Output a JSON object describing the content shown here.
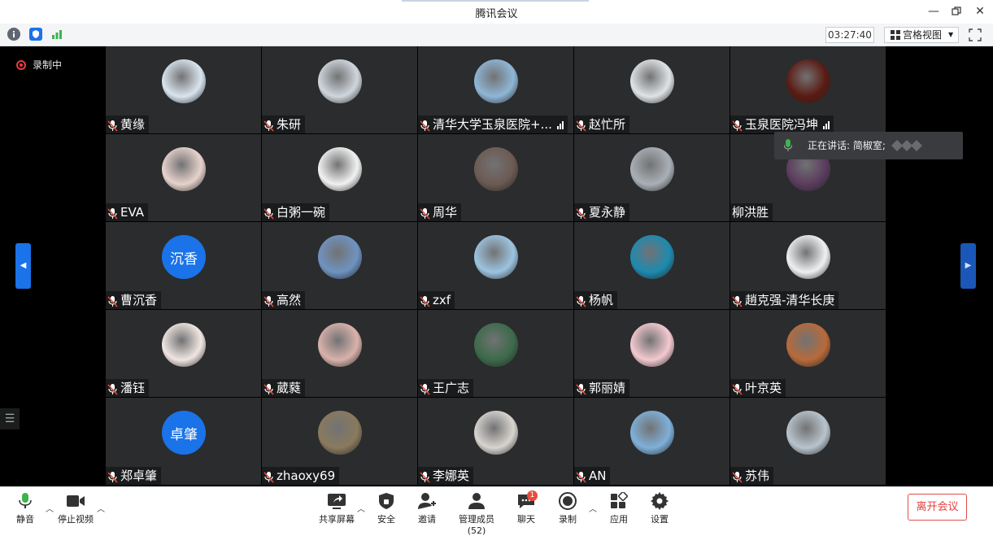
{
  "window": {
    "title": "腾讯会议"
  },
  "toolbar": {
    "timer": "03:27:40",
    "view_label": "宫格视图"
  },
  "recording": {
    "label": "录制中"
  },
  "speaking": {
    "label": "正在讲话: 简椒室;"
  },
  "colors": {
    "accent": "#1a73e8",
    "tile_bg": "#2b2c2e",
    "leave": "#e04040"
  },
  "participants": [
    {
      "name": "黄缘",
      "muted": true,
      "avatar": "photo-light",
      "color": "#d9e4ee"
    },
    {
      "name": "朱研",
      "muted": true,
      "avatar": "photo-person",
      "color": "#cfd6dc"
    },
    {
      "name": "清华大学玉泉医院+...",
      "muted": true,
      "signal": true,
      "avatar": "photo-beach",
      "color": "#8fb6d6"
    },
    {
      "name": "赵忙所",
      "muted": true,
      "avatar": "photo-doctor",
      "color": "#dfe3e6"
    },
    {
      "name": "玉泉医院冯坤",
      "muted": true,
      "signal": true,
      "avatar": "photo-dark-red",
      "color": "#5a1a12"
    },
    {
      "name": "EVA",
      "muted": true,
      "avatar": "photo-cat",
      "color": "#e7d2cc"
    },
    {
      "name": "白粥一碗",
      "muted": true,
      "avatar": "photo-cartoon",
      "color": "#f1f1f1"
    },
    {
      "name": "周华",
      "muted": true,
      "avatar": "photo-sunset",
      "color": "#6c5a52"
    },
    {
      "name": "夏永静",
      "muted": true,
      "avatar": "photo-woman",
      "color": "#a9b0b6"
    },
    {
      "name": "柳洪胜",
      "muted": false,
      "avatar": "photo-flowers",
      "color": "#5b3c5e"
    },
    {
      "name": "曹沉香",
      "muted": true,
      "avatar": "text",
      "avatar_text": "沉香",
      "color": "#1a73e8"
    },
    {
      "name": "高然",
      "muted": true,
      "avatar": "photo-clouds",
      "color": "#6f93c0"
    },
    {
      "name": "zxf",
      "muted": true,
      "avatar": "photo-pavilion",
      "color": "#9cc4e0"
    },
    {
      "name": "杨帆",
      "muted": true,
      "avatar": "photo-sea",
      "color": "#1d8ab0"
    },
    {
      "name": "趙克强-清华长庚",
      "muted": true,
      "avatar": "photo-man-white",
      "color": "#eef0f2"
    },
    {
      "name": "潘钰",
      "muted": true,
      "avatar": "photo-cartoon-girl",
      "color": "#f0e6e1"
    },
    {
      "name": "葳蕤",
      "muted": true,
      "avatar": "photo-hands",
      "color": "#d9b2ab"
    },
    {
      "name": "王广志",
      "muted": true,
      "avatar": "photo-palm",
      "color": "#3c6a4a"
    },
    {
      "name": "郭丽婧",
      "muted": true,
      "avatar": "photo-panda",
      "color": "#f3c9d0"
    },
    {
      "name": "叶京英",
      "muted": true,
      "avatar": "photo-woman-office",
      "color": "#b86a3a"
    },
    {
      "name": "郑卓肇",
      "muted": true,
      "avatar": "text",
      "avatar_text": "卓肇",
      "color": "#1a73e8"
    },
    {
      "name": "zhaoxy69",
      "muted": true,
      "avatar": "photo-road",
      "color": "#8a7a5e"
    },
    {
      "name": "李娜英",
      "muted": true,
      "avatar": "photo-child",
      "color": "#d8d4cf"
    },
    {
      "name": "AN",
      "muted": true,
      "avatar": "photo-pool",
      "color": "#7fb0d9"
    },
    {
      "name": "苏伟",
      "muted": true,
      "avatar": "photo-doctor-mask",
      "color": "#b8c4cc"
    }
  ],
  "bottom_bar": {
    "mute": "静音",
    "stop_video": "停止视频",
    "share_screen": "共享屏幕",
    "security": "安全",
    "invite": "邀请",
    "manage_members": "管理成员(52)",
    "chat": "聊天",
    "chat_badge": "1",
    "record": "录制",
    "apps": "应用",
    "settings": "设置",
    "leave": "离开会议"
  }
}
